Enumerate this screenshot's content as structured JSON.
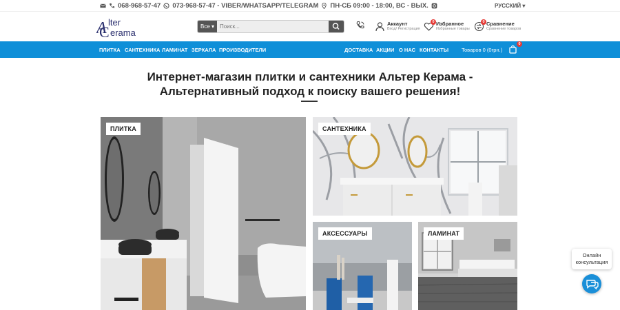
{
  "topbar": {
    "phone1": "068-968-57-47",
    "phone2": "073-968-57-47 - VIBER/WHATSAPP/TELEGRAM",
    "hours": "ПН-СБ 09:00 - 18:00, ВС - ВЫХ.",
    "language": "РУССКИЙ ▾"
  },
  "header": {
    "logo_line1": "lter",
    "logo_line2": "erama",
    "logo_letters": "AC",
    "search": {
      "category": "Все",
      "placeholder": "Поиск..."
    },
    "account": {
      "title": "Аккаунт",
      "subtitle": "Вход/ Регистрация"
    },
    "favorites": {
      "title": "Избранное",
      "subtitle": "Избранные товары",
      "count": "0"
    },
    "compare": {
      "title": "Сравнение",
      "subtitle": "Сравнение товаров",
      "count": "0"
    }
  },
  "nav": {
    "left": [
      "ПЛИТКА",
      "САНТЕХНИКА",
      "ЛАМИНАТ",
      "ЗЕРКАЛА",
      "ПРОИЗВОДИТЕЛИ"
    ],
    "right": [
      "ДОСТАВКА",
      "АКЦИИ",
      "О НАС",
      "КОНТАКТЫ"
    ],
    "cart_text": "Товаров 0 (0грн.)",
    "cart_count": "0"
  },
  "headline": {
    "line1": "Интернет-магазин плитки и сантехники Альтер Керама -",
    "line2": "Альтернативный подход к поиску вашего решения!"
  },
  "tiles": {
    "tile": "ПЛИТКА",
    "plumbing": "САНТЕХНИКА",
    "accessories": "АКСЕССУАРЫ",
    "laminate": "ЛАМИНАТ"
  },
  "chat": {
    "line1": "Онлайн",
    "line2": "консультация"
  },
  "colors": {
    "nav": "#0f8fd8",
    "badge": "#e53935",
    "logo": "#2a2f6e"
  }
}
